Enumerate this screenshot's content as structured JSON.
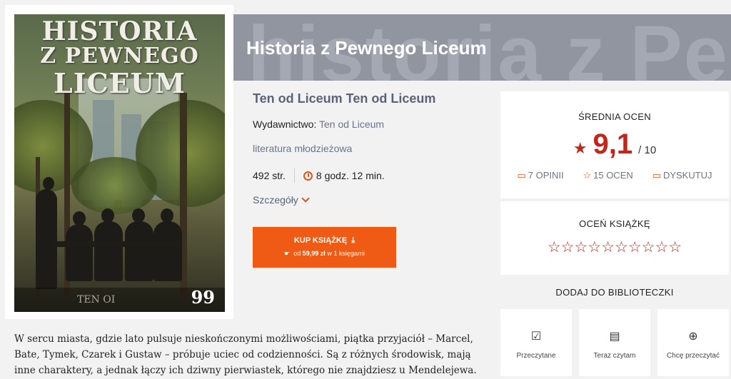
{
  "cover": {
    "title_lines": [
      "HISTORIA",
      "Z PEWNEGO",
      "LICEUM"
    ],
    "author_text": "TEN OI",
    "quote_icon": "99"
  },
  "banner": {
    "bg_text": "historia z Pe",
    "title": "Historia z Pewnego Liceum"
  },
  "book": {
    "author": "Ten od Liceum Ten od Liceum",
    "publisher_label": "Wydawnictwo:",
    "publisher": "Ten od Liceum",
    "genre": "literatura młodzieżowa",
    "pages": "492 str.",
    "reading_time": "8 godz. 12 min.",
    "details": "Szczegóły"
  },
  "buy": {
    "label": "KUP KSIĄŻKĘ",
    "icon": "download-arrow-icon",
    "from": "od",
    "price": "59,99 zł",
    "suffix": "w 1 księgarni"
  },
  "rating": {
    "label": "ŚREDNIA OCEN",
    "score": "9,1",
    "max": "/ 10",
    "opinions": "7 OPINII",
    "ratings": "15 OCEN",
    "discuss": "DYSKUTUJ"
  },
  "rate": {
    "label": "OCEŃ KSIĄŻKĘ",
    "stars": "☆☆☆☆☆☆☆☆☆☆"
  },
  "shelf": {
    "label": "DODAJ DO BIBLIOTECZKI",
    "read": "Przeczytane",
    "reading": "Teraz czytam",
    "want": "Chcę przeczytać"
  },
  "description": "W sercu miasta, gdzie lato pulsuje nieskończonymi możliwościami, piątka przyjaciół – Marcel, Bate, Tymek, Czarek i Gustaw – próbuje uciec od codzienności. Są z różnych środowisk, mają inne charaktery, a jednak łączy ich dziwny pierwiastek, którego nie znajdziesz u Mendelejewa.",
  "colors": {
    "accent": "#ef5a14",
    "score": "#c0281e",
    "banner": "#9095a0"
  }
}
